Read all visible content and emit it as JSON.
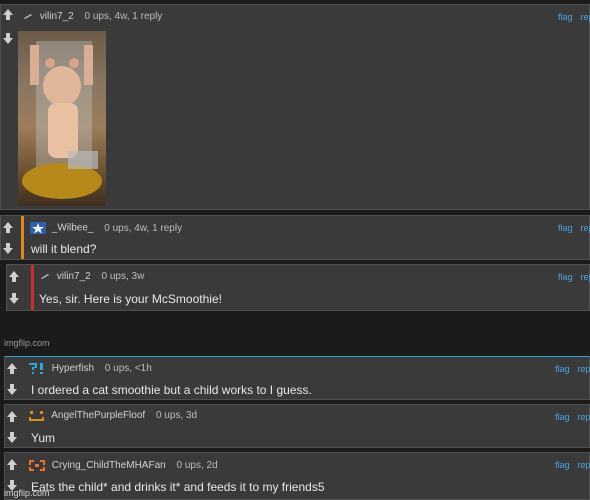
{
  "actions": {
    "flag": "flag",
    "reply": "reply"
  },
  "c1": {
    "user": "vilin7_2",
    "meta": "0 ups, 4w, 1 reply"
  },
  "c2": {
    "user": "_Wilbee_",
    "meta": "0 ups, 4w, 1 reply",
    "text": "will it blend?"
  },
  "c3": {
    "user": "vilin7_2",
    "meta": "0 ups, 3w",
    "text": "Yes, sir. Here is your McSmoothie!"
  },
  "watermark": "imgflip.com",
  "c4": {
    "user": "Hyperfish",
    "meta": "0 ups, <1h",
    "text": "I ordered a cat smoothie but a child works to I guess."
  },
  "c5": {
    "user": "AngelThePurpleFloof",
    "meta": "0 ups, 3d",
    "text": "Yum"
  },
  "c6": {
    "user": "Crying_ChildTheMHAFan",
    "meta": "0 ups, 2d",
    "text": "Eats the child* and drinks it* and feeds it to my friends5"
  },
  "footer_watermark": "imgflip.com",
  "colors": {
    "accent_orange": "#e08a1e",
    "accent_red": "#c8312e",
    "link": "#4aa3df",
    "accent_blue": "#2aa7d8"
  },
  "icons": {
    "upvote": "up-arrow-icon",
    "downvote": "down-arrow-icon"
  }
}
